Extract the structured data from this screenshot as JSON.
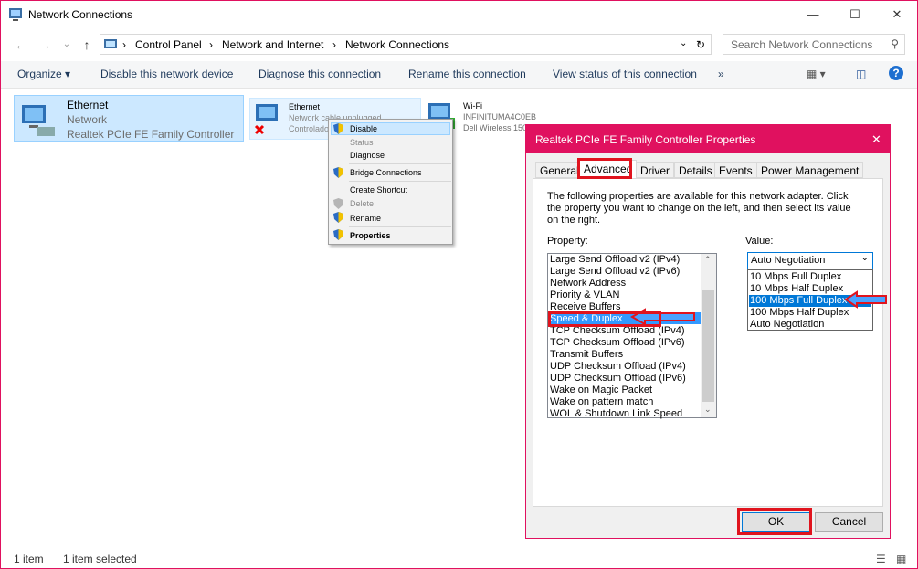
{
  "window": {
    "title": "Network Connections"
  },
  "address": {
    "crumbs": [
      "Control Panel",
      "Network and Internet",
      "Network Connections"
    ],
    "search_placeholder": "Search Network Connections"
  },
  "commands": [
    "Organize ▾",
    "Disable this network device",
    "Diagnose this connection",
    "Rename this connection",
    "View status of this connection",
    "»"
  ],
  "items": [
    {
      "name": "Ethernet",
      "line2": "Network",
      "line3": "Realtek PCIe FE Family Controller"
    },
    {
      "name": "Ethernet",
      "line2": "Network cable unplugged",
      "line3": "Controlado"
    },
    {
      "name": "Wi-Fi",
      "line2": "INFINITUMA4C0EB",
      "line3": "Dell Wireless 150"
    }
  ],
  "context_menu": [
    "Disable",
    "Status",
    "Diagnose",
    "Bridge Connections",
    "Create Shortcut",
    "Delete",
    "Rename",
    "Properties"
  ],
  "dialog": {
    "title": "Realtek PCIe FE Family Controller Properties",
    "tabs": [
      "General",
      "Advanced",
      "Driver",
      "Details",
      "Events",
      "Power Management"
    ],
    "description": "The following properties are available for this network adapter. Click the property you want to change on the left, and then select its value on the right.",
    "property_label": "Property:",
    "value_label": "Value:",
    "properties": [
      "Large Send Offload v2 (IPv4)",
      "Large Send Offload v2 (IPv6)",
      "Network Address",
      "Priority & VLAN",
      "Receive Buffers",
      "Speed & Duplex",
      "TCP Checksum Offload (IPv4)",
      "TCP Checksum Offload (IPv6)",
      "Transmit Buffers",
      "UDP Checksum Offload (IPv4)",
      "UDP Checksum Offload (IPv6)",
      "Wake on Magic Packet",
      "Wake on pattern match",
      "WOL & Shutdown Link Speed"
    ],
    "value_current": "Auto Negotiation",
    "value_options": [
      "10 Mbps Full Duplex",
      "10 Mbps Half Duplex",
      "100 Mbps Full Duplex",
      "100 Mbps Half Duplex",
      "Auto Negotiation"
    ],
    "ok": "OK",
    "cancel": "Cancel"
  },
  "status": {
    "count": "1 item",
    "selected": "1 item selected"
  }
}
